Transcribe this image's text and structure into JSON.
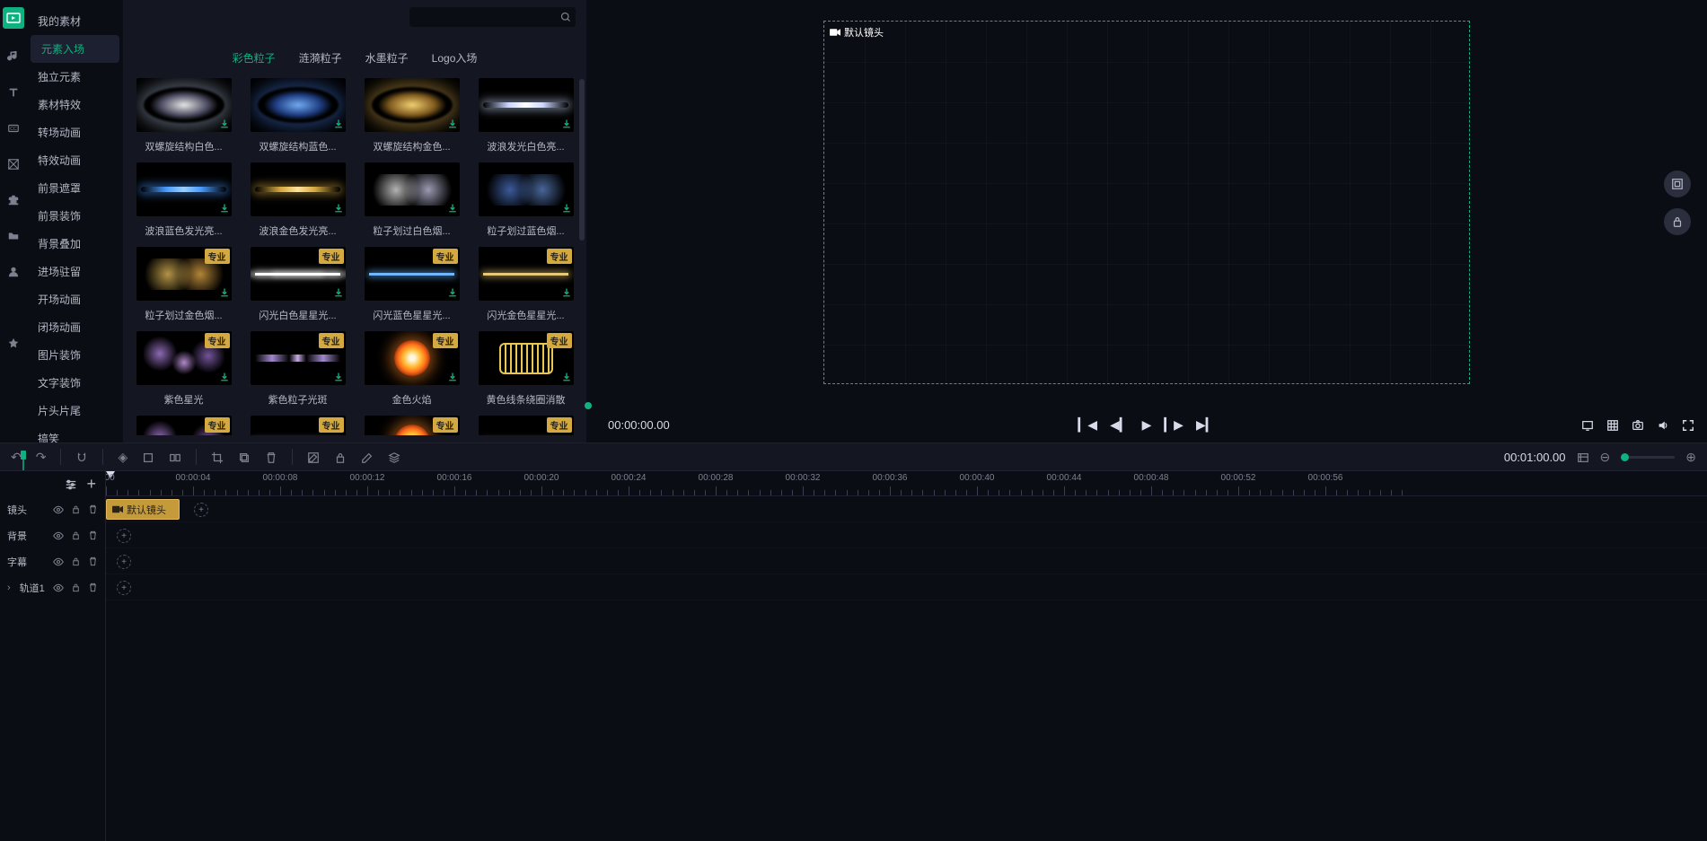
{
  "sidebar_icons": [
    "media",
    "audio",
    "text",
    "subtitle",
    "mask",
    "plugin",
    "folder",
    "person",
    "effects-grid",
    "star"
  ],
  "categories": {
    "items": [
      "我的素材",
      "元素入场",
      "独立元素",
      "素材特效",
      "转场动画",
      "特效动画",
      "前景遮罩",
      "前景装饰",
      "背景叠加",
      "进场驻留",
      "开场动画",
      "闭场动画",
      "图片装饰",
      "文字装饰",
      "片头片尾",
      "搞笑"
    ],
    "active_index": 1
  },
  "search": {
    "placeholder": ""
  },
  "tabs": {
    "items": [
      "彩色粒子",
      "涟漪粒子",
      "水墨粒子",
      "Logo入场"
    ],
    "active_index": 0
  },
  "badges": {
    "pro": "专业"
  },
  "assets": [
    {
      "label": "双螺旋结构白色...",
      "fx": "fx fx-white",
      "pro": false
    },
    {
      "label": "双螺旋结构蓝色...",
      "fx": "fx fx-blue",
      "pro": false
    },
    {
      "label": "双螺旋结构金色...",
      "fx": "fx fx-gold",
      "pro": false
    },
    {
      "label": "波浪发光白色亮...",
      "fx": "fx-wave-white",
      "pro": false
    },
    {
      "label": "波浪蓝色发光亮...",
      "fx": "fx-wave-blue",
      "pro": false
    },
    {
      "label": "波浪金色发光亮...",
      "fx": "fx-wave-gold",
      "pro": false
    },
    {
      "label": "粒子划过白色烟...",
      "fx": "fx-smoke-white",
      "pro": false
    },
    {
      "label": "粒子划过蓝色烟...",
      "fx": "fx-smoke-blue",
      "pro": false
    },
    {
      "label": "粒子划过金色烟...",
      "fx": "fx-smoke-gold",
      "pro": true
    },
    {
      "label": "闪光白色星星光...",
      "fx": "fx-line-white",
      "pro": true
    },
    {
      "label": "闪光蓝色星星光...",
      "fx": "fx-line-blue",
      "pro": true
    },
    {
      "label": "闪光金色星星光...",
      "fx": "fx-line-gold",
      "pro": true
    },
    {
      "label": "紫色星光",
      "fx": "fx-purple-star",
      "pro": true
    },
    {
      "label": "紫色粒子光斑",
      "fx": "fx-purple-spot",
      "pro": true
    },
    {
      "label": "金色火焰",
      "fx": "fx-fire",
      "pro": true
    },
    {
      "label": "黄色线条绕圈消散",
      "fx": "fx-yellow-coil",
      "pro": true
    },
    {
      "label": "",
      "fx": "fx-purple-star",
      "pro": true
    },
    {
      "label": "",
      "fx": "fx-line-white",
      "pro": true
    },
    {
      "label": "",
      "fx": "fx-fire",
      "pro": true
    },
    {
      "label": "",
      "fx": "fx-line-gold",
      "pro": true
    }
  ],
  "preview": {
    "clip_label": "默认镜头",
    "timecode": "00:00:00.00"
  },
  "toolbar": {
    "duration": "00:01:00.00"
  },
  "ruler": {
    "marks": [
      "0:00",
      "00:00:04",
      "00:00:08",
      "00:00:12",
      "00:00:16",
      "00:00:20",
      "00:00:24",
      "00:00:28",
      "00:00:32",
      "00:00:36",
      "00:00:40",
      "00:00:44",
      "00:00:48",
      "00:00:52",
      "00:00:56"
    ]
  },
  "tracks": [
    {
      "label": "镜头",
      "clip": "默认镜头"
    },
    {
      "label": "背景"
    },
    {
      "label": "字幕"
    },
    {
      "label": "轨道1",
      "chev": true
    }
  ]
}
